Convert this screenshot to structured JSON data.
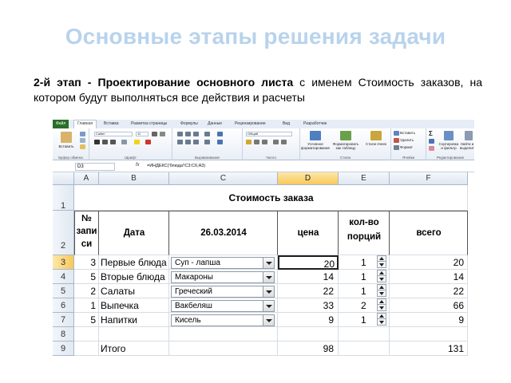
{
  "slide": {
    "title": "Основные этапы решения задачи",
    "text_bold": "2-й этап - Проектирование основного листа",
    "text_rest": " с именем Стоимость заказов, на котором будут выполняться все действия и расчеты"
  },
  "excel": {
    "tabs": [
      "Файл",
      "Главная",
      "Вставка",
      "Разметка страницы",
      "Формулы",
      "Данные",
      "Рецензирование",
      "Вид",
      "Разработчик"
    ],
    "ribbon": {
      "paste_label": "Вставить",
      "font_name": "Calibri",
      "font_size": "11",
      "number_format": "Общий",
      "groups": [
        "Буфер обмена",
        "Шрифт",
        "Выравнивание",
        "Число",
        "Стили",
        "Ячейки",
        "Редактирование"
      ],
      "styles_buttons": [
        "Условное форматирование",
        "Форматировать как таблицу",
        "Стили ячеек"
      ],
      "cells_buttons": [
        "Вставить",
        "Удалить",
        "Формат"
      ],
      "edit_buttons": [
        "Сортировка и фильтр",
        "Найти и выделить"
      ]
    },
    "name_box": "D3",
    "formula": "=ИНДЕКС('блюда'!C3:C6;A3)",
    "columns": [
      "A",
      "B",
      "C",
      "D",
      "E",
      "F"
    ],
    "rows": [
      "1",
      "2",
      "3",
      "4",
      "5",
      "6",
      "7",
      "8",
      "9"
    ],
    "table_title": "Стоимость заказа",
    "headers": {
      "num_line1": "№",
      "num_line2": "запи",
      "num_line3": "си",
      "date": "Дата",
      "date_value": "26.03.2014",
      "price": "цена",
      "portions_line1": "кол-во",
      "portions_line2": "порций",
      "total": "всего"
    },
    "data_rows": [
      {
        "num": "3",
        "category": "Первые блюда",
        "dish": "Суп - лапша",
        "price": "20",
        "qty": "1",
        "total": "20"
      },
      {
        "num": "5",
        "category": "Вторые блюда",
        "dish": "Макароны",
        "price": "14",
        "qty": "1",
        "total": "14"
      },
      {
        "num": "2",
        "category": "Салаты",
        "dish": "Греческий",
        "price": "22",
        "qty": "1",
        "total": "22"
      },
      {
        "num": "1",
        "category": "Выпечка",
        "dish": "Вакбеляш",
        "price": "33",
        "qty": "2",
        "total": "66"
      },
      {
        "num": "5",
        "category": "Напитки",
        "dish": "Кисель",
        "price": "9",
        "qty": "1",
        "total": "9"
      }
    ],
    "totals": {
      "label": "Итого",
      "price": "98",
      "total": "131"
    }
  }
}
